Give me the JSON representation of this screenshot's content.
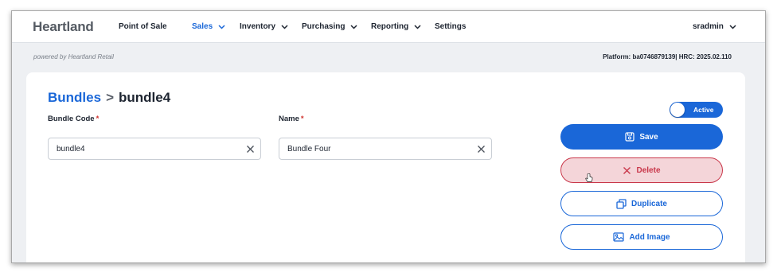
{
  "nav": {
    "brand": "Heartland",
    "items": [
      {
        "label": "Point of Sale",
        "dropdown": false,
        "active": false
      },
      {
        "label": "Sales",
        "dropdown": true,
        "active": true
      },
      {
        "label": "Inventory",
        "dropdown": true,
        "active": false
      },
      {
        "label": "Purchasing",
        "dropdown": true,
        "active": false
      },
      {
        "label": "Reporting",
        "dropdown": true,
        "active": false
      },
      {
        "label": "Settings",
        "dropdown": false,
        "active": false
      }
    ],
    "user": "sradmin"
  },
  "subbar": {
    "powered_by": "powered by Heartland Retail",
    "platform": "Platform: ba0746879139| HRC: 2025.02.110"
  },
  "breadcrumb": {
    "parent": "Bundles",
    "separator": ">",
    "current": "bundle4"
  },
  "form": {
    "bundle_code": {
      "label": "Bundle Code",
      "required_mark": "*",
      "value": "bundle4"
    },
    "name": {
      "label": "Name",
      "required_mark": "*",
      "value": "Bundle Four"
    }
  },
  "status_toggle": {
    "label": "Active",
    "on": true
  },
  "actions": {
    "save": "Save",
    "delete": "Delete",
    "duplicate": "Duplicate",
    "add_image": "Add Image"
  },
  "icons": {
    "save": "save-icon",
    "delete": "close-icon",
    "duplicate": "copy-icon",
    "add_image": "image-icon",
    "clear": "clear-icon",
    "dropdown": "chevron-down-icon"
  },
  "colors": {
    "accent": "#1a67d8",
    "danger": "#c9374a",
    "danger_bg": "#f4d5d9",
    "text": "#1d2430",
    "page_bg": "#eef0f3"
  }
}
